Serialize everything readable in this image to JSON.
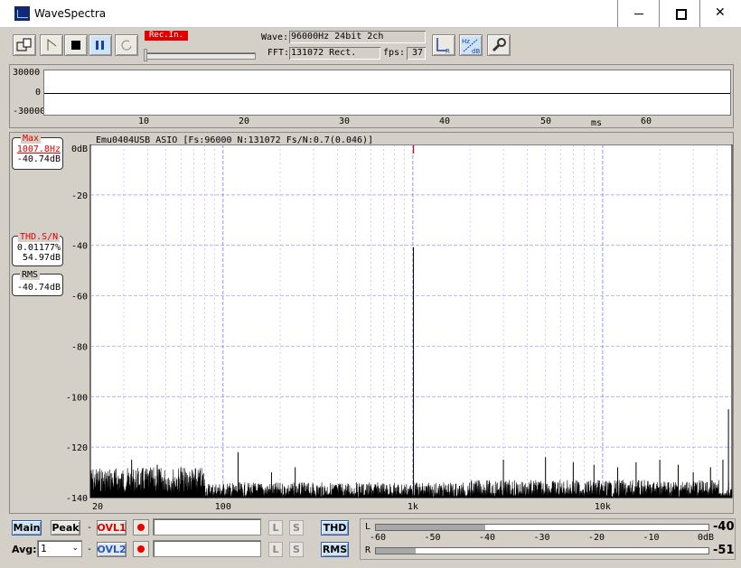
{
  "window": {
    "title": "WaveSpectra"
  },
  "toolbar": {
    "rec_status": "Rec.In.",
    "wave_label": "Wave:",
    "wave_value": "96000Hz 24bit 2ch",
    "fft_label": "FFT:",
    "fft_value": "131072 Rect.",
    "fps_label": "fps:",
    "fps_value": "37",
    "lr_button": "LR",
    "hz_db_button": "HzdB"
  },
  "wave": {
    "y_ticks": [
      "30000",
      "0",
      "-30000"
    ],
    "x_ticks": [
      "10",
      "20",
      "30",
      "40",
      "50",
      "60"
    ],
    "x_unit": "ms"
  },
  "spectrum": {
    "header": "Emu0404USB ASIO   [Fs:96000 N:131072 Fs/N:0.7(0.046)]",
    "max": {
      "title": "Max",
      "freq": "1007.8Hz",
      "level": "-40.74dB"
    },
    "thd": {
      "title": "THD.S/N",
      "thd": "0.01177%",
      "sn": "54.97dB"
    },
    "rms": {
      "title": "RMS",
      "level": "-40.74dB"
    }
  },
  "chart_data": {
    "type": "line",
    "title": "",
    "xscale": "log",
    "xlim": [
      20,
      48000
    ],
    "ylim": [
      -140,
      0
    ],
    "x_ticks": [
      "20",
      "100",
      "1k",
      "10k"
    ],
    "y_ticks": [
      "0dB",
      "-20",
      "-40",
      "-60",
      "-80",
      "-100",
      "-120",
      "-140"
    ],
    "grid": true,
    "series": [
      {
        "peaks": [
          [
            1007.8,
            -40.7
          ],
          [
            120,
            -122
          ],
          [
            60,
            -128
          ],
          [
            33,
            -125
          ],
          [
            45,
            -127
          ],
          [
            180,
            -130
          ],
          [
            240,
            -128
          ],
          [
            3000,
            -125
          ],
          [
            5000,
            -124
          ],
          [
            7000,
            -126
          ],
          [
            9000,
            -127
          ],
          [
            12000,
            -128
          ],
          [
            15000,
            -126
          ],
          [
            20000,
            -125
          ],
          [
            25000,
            -127
          ],
          [
            30000,
            -130
          ],
          [
            37000,
            -128
          ],
          [
            43000,
            -125
          ],
          [
            46000,
            -105
          ]
        ]
      }
    ]
  },
  "bottom": {
    "main_button": "Main",
    "peak_button": "Peak",
    "dash1": "-",
    "dash2": "-",
    "ovl1": "OVL1",
    "ovl2": "OVL2",
    "l_label": "L",
    "s_label": "S",
    "avg_label": "Avg:",
    "avg_value": "1",
    "thd_button": "THD",
    "rms_button": "RMS",
    "meter_l_label": "L",
    "meter_r_label": "R",
    "meter_scale": [
      "-60",
      "-50",
      "-40",
      "-30",
      "-20",
      "-10",
      "0dB"
    ],
    "meter_l_value": "-40",
    "meter_r_value": "-51",
    "meter_l_fill": 0.33,
    "meter_r_fill": 0.12
  },
  "colors": {
    "peak_marker": "#e00000",
    "grid": "#7a7aff",
    "highlight_button": "#cfe3f7"
  }
}
